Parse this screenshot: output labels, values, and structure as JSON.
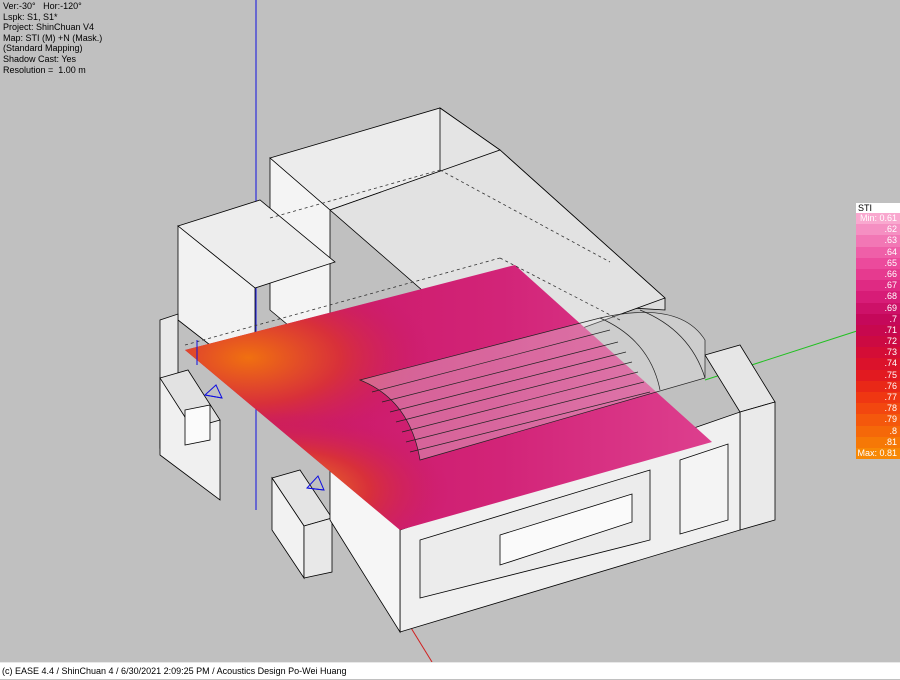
{
  "info_lines": [
    "Ver:-30°   Hor:-120°",
    "Lspk: S1, S1*",
    "Project: ShinChuan V4",
    "Map: STI (M) +N (Mask.)",
    "(Standard Mapping)",
    "Shadow Cast: Yes",
    "Resolution =  1.00 m"
  ],
  "legend": {
    "title": "STI",
    "entries": [
      {
        "label": "Min:  0.61",
        "color": "#f9a8cf"
      },
      {
        "label": ".62",
        "color": "#f58fc2"
      },
      {
        "label": ".63",
        "color": "#f277b5"
      },
      {
        "label": ".64",
        "color": "#ef5fa8"
      },
      {
        "label": ".65",
        "color": "#ec4a9c"
      },
      {
        "label": ".66",
        "color": "#e63a8f"
      },
      {
        "label": ".67",
        "color": "#df2a83"
      },
      {
        "label": ".68",
        "color": "#d71c77"
      },
      {
        "label": ".69",
        "color": "#cd1168"
      },
      {
        "label": ".7",
        "color": "#c5085a"
      },
      {
        "label": ".71",
        "color": "#c7084e"
      },
      {
        "label": ".72",
        "color": "#cc0a42"
      },
      {
        "label": ".73",
        "color": "#d40d36"
      },
      {
        "label": ".74",
        "color": "#db122b"
      },
      {
        "label": ".75",
        "color": "#e21a20"
      },
      {
        "label": ".76",
        "color": "#e92817"
      },
      {
        "label": ".77",
        "color": "#ef3712"
      },
      {
        "label": ".78",
        "color": "#f2470f"
      },
      {
        "label": ".79",
        "color": "#f4580c"
      },
      {
        "label": ".8",
        "color": "#f56809"
      },
      {
        "label": ".81",
        "color": "#f67806"
      },
      {
        "label": "Max:  0.81",
        "color": "#f78805"
      }
    ]
  },
  "status_bar": "(c) EASE 4.4  / ShinChuan 4 / 6/30/2021 2:09:25 PM / Acoustics Design Po-Wei Huang"
}
